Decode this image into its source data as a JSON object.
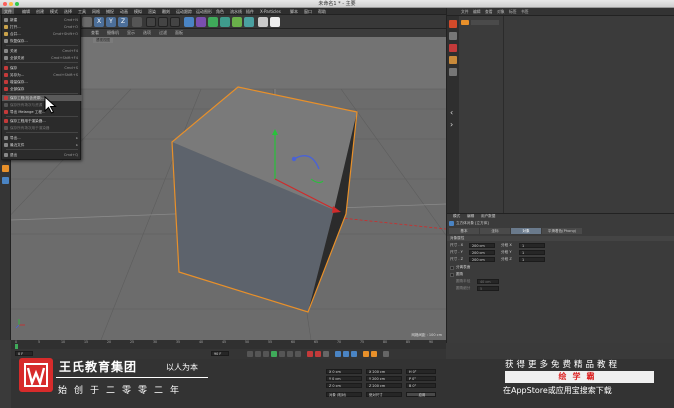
{
  "window": {
    "title": "未命名1 * - 主要"
  },
  "menubar": {
    "items": [
      "文件",
      "编辑",
      "创建",
      "模式",
      "选择",
      "工具",
      "网格",
      "捕捉",
      "动画",
      "模拟",
      "渲染",
      "雕刻",
      "运动跟踪",
      "运动图形",
      "角色",
      "流水线",
      "插件",
      "X-Particles",
      "脚本",
      "窗口",
      "帮助"
    ]
  },
  "file_menu": {
    "items": [
      {
        "label": "新建",
        "shortcut": "Cmd+N"
      },
      {
        "label": "打开...",
        "shortcut": "Cmd+O"
      },
      {
        "label": "合并...",
        "shortcut": "Cmd+Shift+O"
      },
      {
        "label": "恢复保存...",
        "shortcut": ""
      },
      {
        "label": "关闭",
        "shortcut": "Cmd+F4"
      },
      {
        "label": "全部关闭",
        "shortcut": "Cmd+Shift+F4"
      },
      {
        "label": "保存",
        "shortcut": "Cmd+S"
      },
      {
        "label": "另存为...",
        "shortcut": "Cmd+Shift+S"
      },
      {
        "label": "增量保存...",
        "shortcut": ""
      },
      {
        "label": "全部保存",
        "shortcut": ""
      },
      {
        "label": "保存工程(包含资源)...",
        "shortcut": ""
      },
      {
        "label": "保存所有场次与资源",
        "shortcut": ""
      },
      {
        "label": "导出 Melange 工程...",
        "shortcut": ""
      },
      {
        "label": "保存工程用于渲染器...",
        "shortcut": ""
      },
      {
        "label": "保存所有场次用于渲染器",
        "shortcut": ""
      },
      {
        "label": "导出...",
        "shortcut": ""
      },
      {
        "label": "最近文件",
        "shortcut": ""
      },
      {
        "label": "退出",
        "shortcut": "Cmd+Q"
      }
    ],
    "highlighted_index": 10,
    "disabled_indices": [
      11,
      14
    ]
  },
  "toolbar": {
    "axis_buttons": [
      "X",
      "Y",
      "Z"
    ]
  },
  "viewport": {
    "menu": [
      "查看",
      "摄像机",
      "显示",
      "选项",
      "过滤",
      "面板"
    ],
    "camera_label": "透视视图",
    "grid_info": "网格间距 : 100 cm"
  },
  "object_manager": {
    "tabs": [
      "文件",
      "编辑",
      "查看",
      "对象",
      "标签",
      "书签"
    ]
  },
  "attribute_manager": {
    "header": [
      "模式",
      "编辑",
      "用户数据"
    ],
    "object_name": "立方体对象 [立方体]",
    "tabs": [
      "基本",
      "坐标",
      "对象",
      "平滑着色(Phong)"
    ],
    "active_tab": "对象",
    "section": "对象属性",
    "size_x": {
      "label": "尺寸 . X",
      "value": "200 cm"
    },
    "size_y": {
      "label": "尺寸 . Y",
      "value": "200 cm"
    },
    "size_z": {
      "label": "尺寸 . Z",
      "value": "200 cm"
    },
    "seg_x": {
      "label": "分段 X",
      "value": "1"
    },
    "seg_y": {
      "label": "分段 Y",
      "value": "1"
    },
    "seg_z": {
      "label": "分段 Z",
      "value": "1"
    },
    "sep_surface": "分离表面",
    "fillet": "圆角",
    "fillet_radius": {
      "label": "圆角半径",
      "value": "40 cm"
    },
    "fillet_sub": {
      "label": "圆角细分",
      "value": "5"
    }
  },
  "timeline": {
    "ticks": [
      "0",
      "5",
      "10",
      "15",
      "20",
      "25",
      "30",
      "35",
      "40",
      "45",
      "50",
      "55",
      "60",
      "65",
      "70",
      "75",
      "80",
      "85",
      "90"
    ],
    "current": "0 F",
    "end": "90 F"
  },
  "coords": {
    "pos": [
      "X  0 cm",
      "Y  0 cm",
      "Z  0 cm"
    ],
    "size": [
      "X  200 cm",
      "Y  200 cm",
      "Z  200 cm"
    ],
    "rot": [
      "H  0°",
      "P  0°",
      "B  0°"
    ],
    "mode": "对象 (相对)",
    "size_mode": "绝对尺寸",
    "apply": "应用"
  },
  "watermark": {
    "brand": "王氏教育集团",
    "tag": "以人为本",
    "slogan": "始创于二零零二年",
    "promo1": "获得更多免费精品教程",
    "promo2": "绘学霸",
    "promo3": "在AppStore或应用宝搜索下载"
  },
  "colors": {
    "accent_orange": "#e8902a",
    "highlight": "#5a5a5a",
    "active_tab": "#6a7a8c",
    "brand_red": "#d72b2b"
  }
}
